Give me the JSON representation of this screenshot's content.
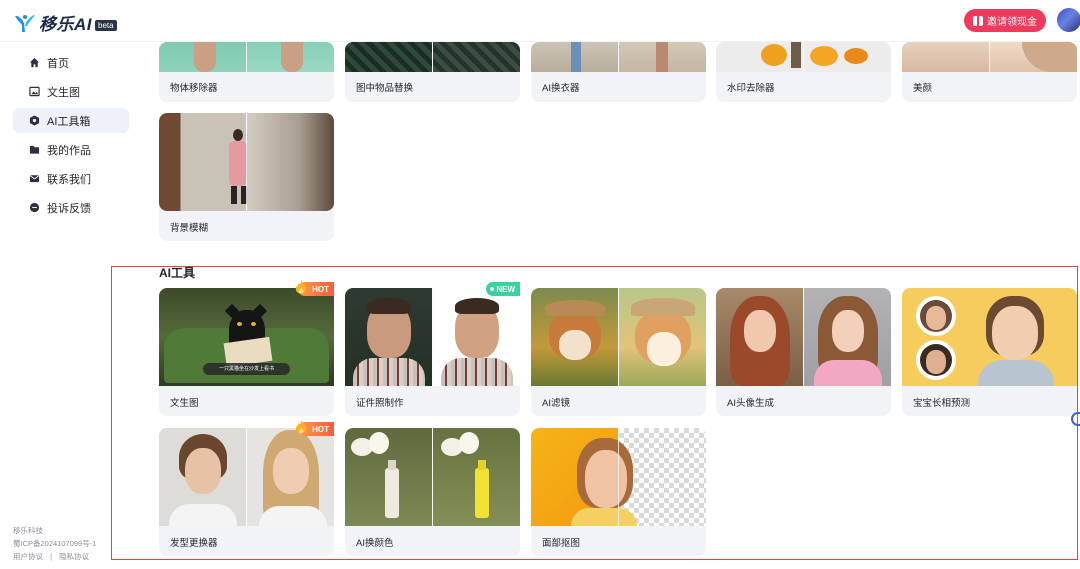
{
  "header": {
    "logo_text": "移乐AI",
    "beta_label": "beta",
    "invite_label": "邀请领现金"
  },
  "sidebar": {
    "items": [
      {
        "label": "首页",
        "icon": "home-icon"
      },
      {
        "label": "文生图",
        "icon": "image-icon"
      },
      {
        "label": "AI工具箱",
        "icon": "toolbox-icon",
        "active": true
      },
      {
        "label": "我的作品",
        "icon": "folder-icon"
      },
      {
        "label": "联系我们",
        "icon": "mail-icon"
      },
      {
        "label": "投诉反馈",
        "icon": "feedback-icon"
      }
    ],
    "footer": {
      "company": "移乐科技",
      "icp": "蜀ICP备2024107099号-1",
      "user_agreement": "用户协议",
      "separator": "|",
      "privacy_policy": "隐私协议"
    }
  },
  "upper_tools": {
    "items": [
      {
        "label": "物体移除器"
      },
      {
        "label": "图中物品替换"
      },
      {
        "label": "AI换衣器"
      },
      {
        "label": "水印去除器"
      },
      {
        "label": "美颜"
      },
      {
        "label": "背景模糊"
      }
    ]
  },
  "ai_tools": {
    "title": "AI工具",
    "items": [
      {
        "label": "文生图",
        "badge": "HOT",
        "caption": "一只黑猫坐在沙发上看书"
      },
      {
        "label": "证件照制作",
        "badge": "NEW"
      },
      {
        "label": "AI滤镜"
      },
      {
        "label": "AI头像生成"
      },
      {
        "label": "宝宝长相预测"
      },
      {
        "label": "发型更换器",
        "badge": "HOT"
      },
      {
        "label": "AI换颜色"
      },
      {
        "label": "面部抠图"
      }
    ]
  },
  "colors": {
    "accent": "#ee3a5c",
    "active_nav_bg": "#eef1f7",
    "card_bg": "#f2f3f6",
    "highlight_border": "#e2453c",
    "hot_badge": "#ff6a3d",
    "new_badge": "#3ad3a0"
  }
}
